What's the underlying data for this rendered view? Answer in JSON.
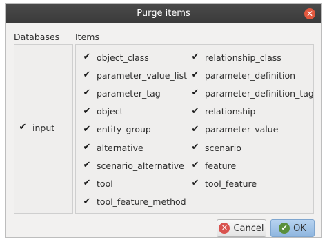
{
  "dialog": {
    "title": "Purge items",
    "databases_header": "Databases",
    "items_header": "Items"
  },
  "databases": [
    {
      "label": "input",
      "checked": true
    }
  ],
  "items_col1": [
    {
      "label": "object_class",
      "checked": true
    },
    {
      "label": "parameter_value_list",
      "checked": true
    },
    {
      "label": "parameter_tag",
      "checked": true
    },
    {
      "label": "object",
      "checked": true
    },
    {
      "label": "entity_group",
      "checked": true
    },
    {
      "label": "alternative",
      "checked": true
    },
    {
      "label": "scenario_alternative",
      "checked": true
    },
    {
      "label": "tool",
      "checked": true
    },
    {
      "label": "tool_feature_method",
      "checked": true
    }
  ],
  "items_col2": [
    {
      "label": "relationship_class",
      "checked": true
    },
    {
      "label": "parameter_definition",
      "checked": true
    },
    {
      "label": "parameter_definition_tag",
      "checked": true
    },
    {
      "label": "relationship",
      "checked": true
    },
    {
      "label": "parameter_value",
      "checked": true
    },
    {
      "label": "scenario",
      "checked": true
    },
    {
      "label": "feature",
      "checked": true
    },
    {
      "label": "tool_feature",
      "checked": true
    }
  ],
  "buttons": {
    "cancel_prefix": "C",
    "cancel_rest": "ancel",
    "ok_prefix": "O",
    "ok_rest": "K"
  },
  "colors": {
    "titlebar": "#3f3f3f",
    "close": "#e2583e",
    "cancel_icon": "#d9534f",
    "ok_icon": "#5a8f3c",
    "ok_button_bg": "#9ec1e6"
  },
  "icons": {
    "close": "close-icon",
    "cancel": "cancel-icon",
    "ok": "ok-icon",
    "check": "checkmark-icon"
  }
}
